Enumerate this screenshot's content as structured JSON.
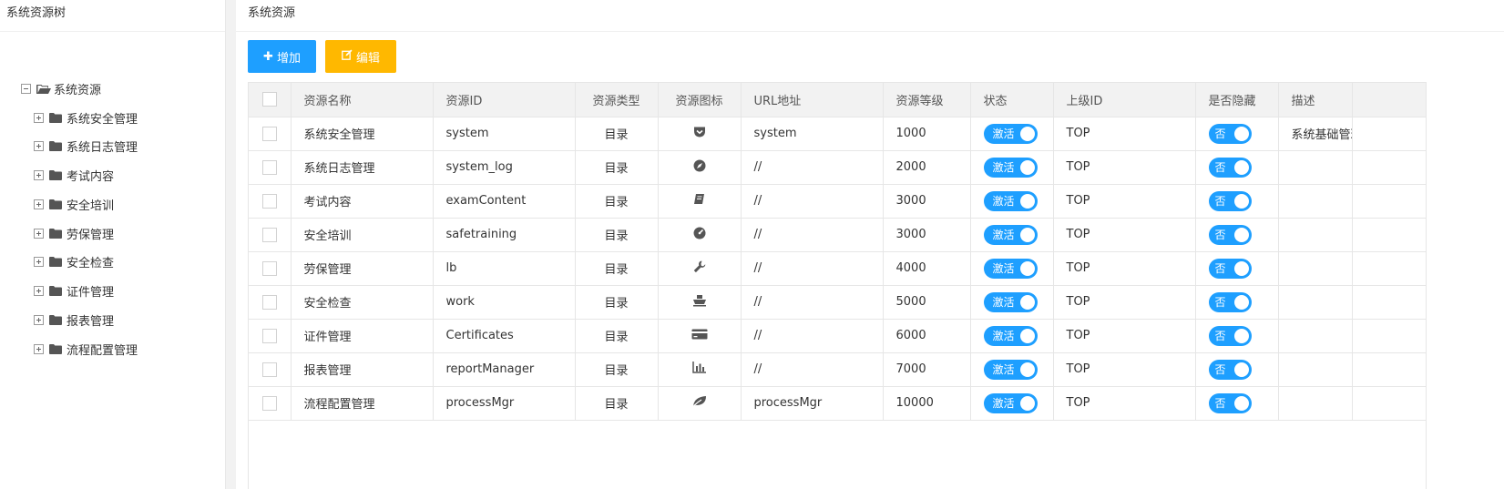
{
  "left": {
    "title": "系统资源树",
    "root": "系统资源",
    "children": [
      "系统安全管理",
      "系统日志管理",
      "考试内容",
      "安全培训",
      "劳保管理",
      "安全检查",
      "证件管理",
      "报表管理",
      "流程配置管理"
    ]
  },
  "right": {
    "title": "系统资源",
    "add_label": "增加",
    "edit_label": "编辑"
  },
  "table": {
    "headers": [
      "资源名称",
      "资源ID",
      "资源类型",
      "资源图标",
      "URL地址",
      "资源等级",
      "状态",
      "上级ID",
      "是否隐藏",
      "描述"
    ],
    "rows": [
      {
        "name": "系统安全管理",
        "id": "system",
        "type": "目录",
        "icon": "shield-icon",
        "url": "system",
        "level": "1000",
        "state": "激活",
        "parent": "TOP",
        "hidden": "否",
        "desc": "系统基础管理"
      },
      {
        "name": "系统日志管理",
        "id": "system_log",
        "type": "目录",
        "icon": "compass-icon",
        "url": "//",
        "level": "2000",
        "state": "激活",
        "parent": "TOP",
        "hidden": "否",
        "desc": ""
      },
      {
        "name": "考试内容",
        "id": "examContent",
        "type": "目录",
        "icon": "book-icon",
        "url": "//",
        "level": "3000",
        "state": "激活",
        "parent": "TOP",
        "hidden": "否",
        "desc": ""
      },
      {
        "name": "安全培训",
        "id": "safetraining",
        "type": "目录",
        "icon": "gauge-icon",
        "url": "//",
        "level": "3000",
        "state": "激活",
        "parent": "TOP",
        "hidden": "否",
        "desc": ""
      },
      {
        "name": "劳保管理",
        "id": "lb",
        "type": "目录",
        "icon": "wrench-icon",
        "url": "//",
        "level": "4000",
        "state": "激活",
        "parent": "TOP",
        "hidden": "否",
        "desc": ""
      },
      {
        "name": "安全检查",
        "id": "work",
        "type": "目录",
        "icon": "ship-icon",
        "url": "//",
        "level": "5000",
        "state": "激活",
        "parent": "TOP",
        "hidden": "否",
        "desc": ""
      },
      {
        "name": "证件管理",
        "id": "Certificates",
        "type": "目录",
        "icon": "credit-card-icon",
        "url": "//",
        "level": "6000",
        "state": "激活",
        "parent": "TOP",
        "hidden": "否",
        "desc": ""
      },
      {
        "name": "报表管理",
        "id": "reportManager",
        "type": "目录",
        "icon": "bar-chart-icon",
        "url": "//",
        "level": "7000",
        "state": "激活",
        "parent": "TOP",
        "hidden": "否",
        "desc": ""
      },
      {
        "name": "流程配置管理",
        "id": "processMgr",
        "type": "目录",
        "icon": "leaf-icon",
        "url": "processMgr",
        "level": "10000",
        "state": "激活",
        "parent": "TOP",
        "hidden": "否",
        "desc": ""
      }
    ]
  },
  "colors": {
    "primary": "#1e9fff",
    "warning": "#ffb800",
    "icon": "#555555"
  }
}
